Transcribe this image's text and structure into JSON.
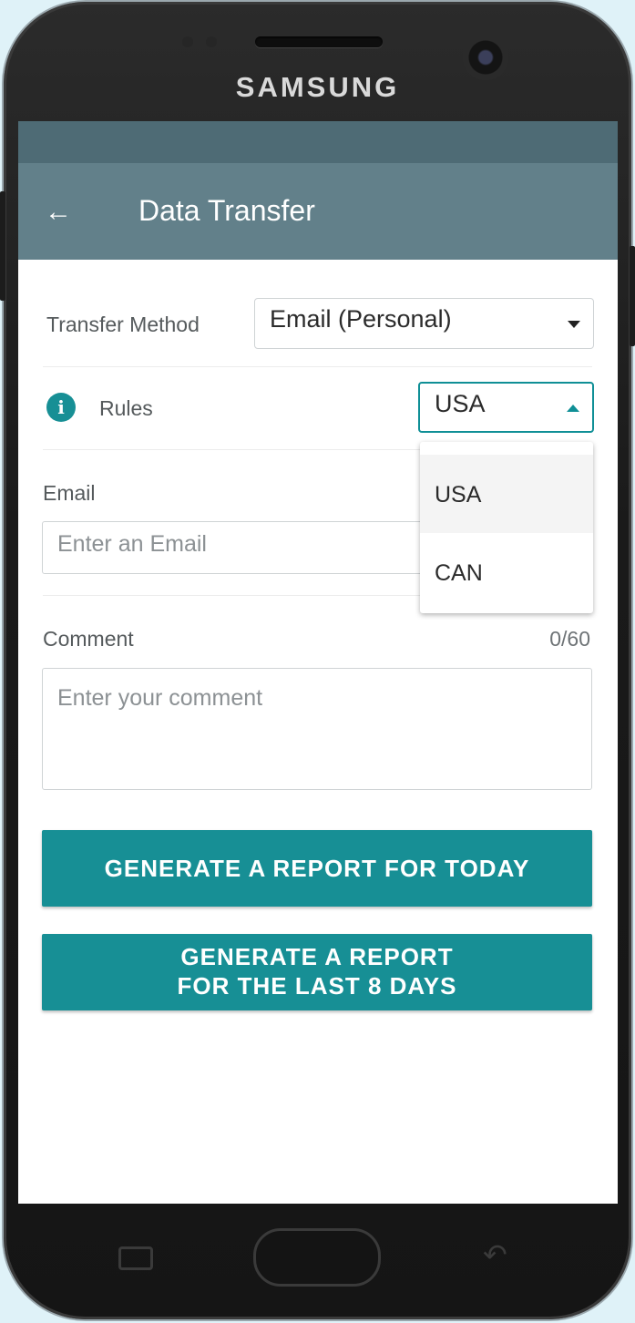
{
  "device": {
    "brand": "SAMSUNG"
  },
  "header": {
    "title": "Data Transfer",
    "back_icon": "arrow-left-icon"
  },
  "form": {
    "transfer_method": {
      "label": "Transfer Method",
      "value": "Email (Personal)"
    },
    "rules": {
      "label": "Rules",
      "value": "USA",
      "options": [
        "USA",
        "CAN"
      ],
      "open": true
    },
    "email": {
      "label": "Email",
      "placeholder": "Enter an Email"
    },
    "comment": {
      "label": "Comment",
      "counter": "0/60",
      "placeholder": "Enter your comment"
    }
  },
  "buttons": {
    "today": "GENERATE A REPORT FOR TODAY",
    "last8_line1": "GENERATE A REPORT",
    "last8_line2": "FOR THE LAST 8 DAYS"
  },
  "colors": {
    "primary": "#178f95",
    "appbar": "#62808a",
    "statusbar": "#4e6b75"
  }
}
